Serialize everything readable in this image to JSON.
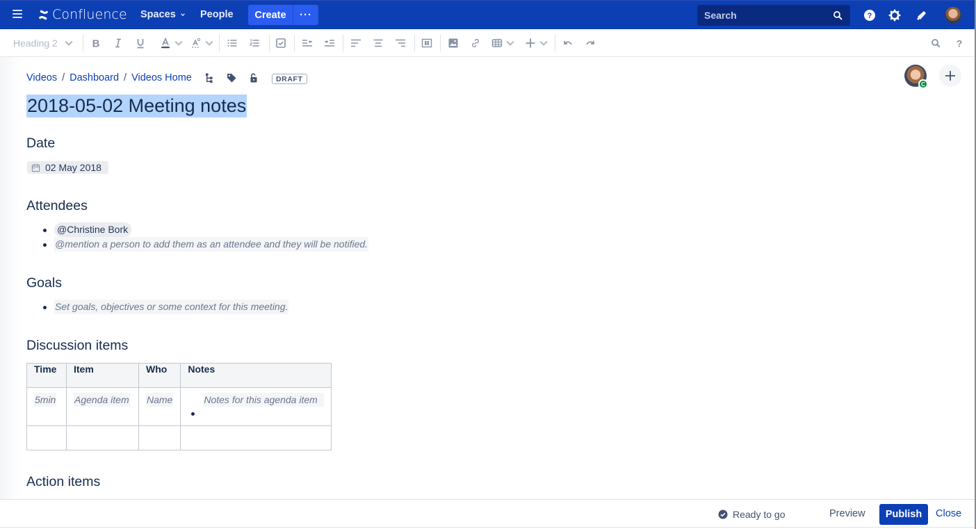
{
  "app": {
    "name": "Confluence",
    "brand_color": "#0d3fb4",
    "accent_color": "#2b5cf0"
  },
  "topnav": {
    "menu_icon": "hamburger-icon",
    "logo_icon": "confluence-logo-icon",
    "logo_text": "Confluence",
    "spaces_label": "Spaces",
    "people_label": "People",
    "create_label": "Create",
    "more_label": "···",
    "search_placeholder": "Search",
    "icons": [
      "search-icon",
      "help-icon",
      "gear-icon",
      "notifications-megaphone-icon",
      "user-avatar"
    ]
  },
  "toolbar": {
    "text_style": "Heading 2",
    "buttons": [
      "bold",
      "italic",
      "underline",
      "text-color",
      "text-effects",
      "bullet-list",
      "numbered-list",
      "task-list",
      "outdent",
      "indent",
      "align-left",
      "align-center",
      "align-right",
      "page-layout",
      "insert-image",
      "insert-link",
      "insert-table",
      "insert-more",
      "undo",
      "redo",
      "find-replace",
      "keyboard-shortcuts-help"
    ]
  },
  "page": {
    "breadcrumb": [
      "Videos",
      "Dashboard",
      "Videos Home"
    ],
    "breadcrumb_sep": "/",
    "status_badge": "DRAFT",
    "collaborator_initial": "C",
    "title": "2018-05-02 Meeting notes",
    "sections": {
      "date": {
        "heading": "Date",
        "value": "02 May 2018"
      },
      "attendees": {
        "heading": "Attendees",
        "mention": "@Christine Bork",
        "placeholder": "@mention a person to add them as an attendee and they will be notified."
      },
      "goals": {
        "heading": "Goals",
        "placeholder": "Set goals, objectives or some context for this meeting."
      },
      "discussion": {
        "heading": "Discussion items",
        "columns": [
          "Time",
          "Item",
          "Who",
          "Notes"
        ],
        "rows": [
          [
            "5min",
            "Agenda item",
            "Name",
            "Notes for this agenda item"
          ],
          [
            "",
            "",
            "",
            ""
          ]
        ]
      },
      "actions": {
        "heading": "Action items"
      }
    }
  },
  "bottombar": {
    "status": "Ready to go",
    "preview_label": "Preview",
    "publish_label": "Publish",
    "close_label": "Close"
  }
}
